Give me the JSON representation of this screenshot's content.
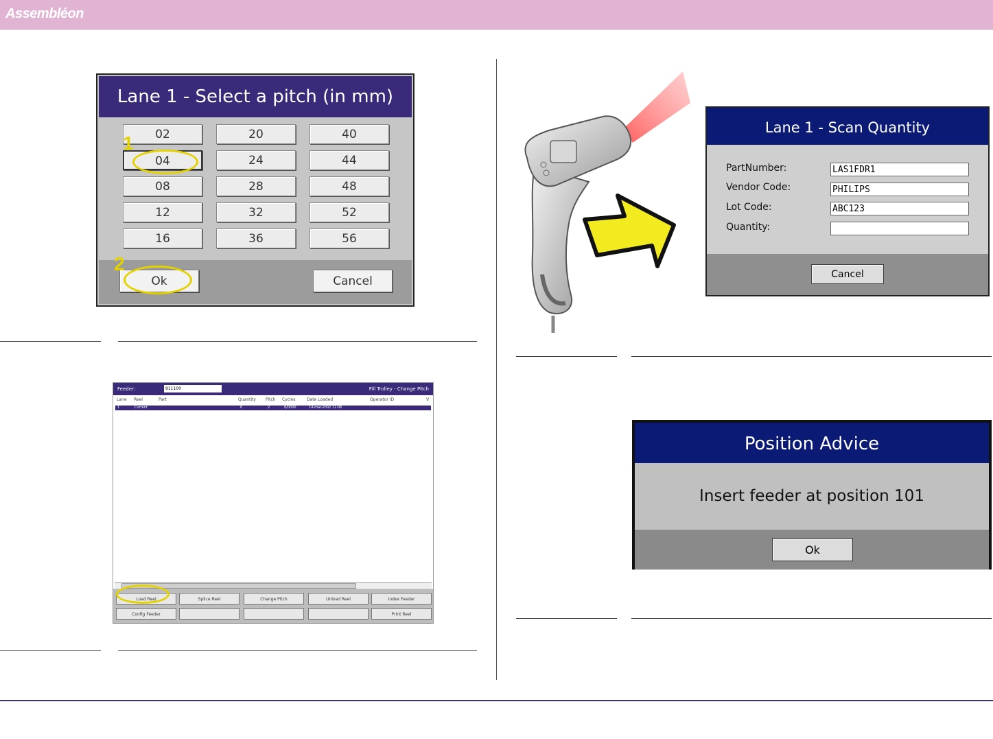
{
  "header": {
    "logo": "Assembléon",
    "bar_color": "#e2b4d4"
  },
  "pitch_dialog": {
    "title": "Lane 1 - Select a pitch (in mm)",
    "options": [
      [
        "02",
        "20",
        "40"
      ],
      [
        "04",
        "24",
        "44"
      ],
      [
        "08",
        "28",
        "48"
      ],
      [
        "12",
        "32",
        "52"
      ],
      [
        "16",
        "36",
        "56"
      ]
    ],
    "selected": "04",
    "ok_label": "Ok",
    "cancel_label": "Cancel",
    "markers": [
      "1",
      "2"
    ]
  },
  "trolley_screen": {
    "feeder_label": "Feeder:",
    "feeder_value": "911100",
    "mode": "Fill Trolley - Change Pitch",
    "columns": [
      "Lane",
      "Reel",
      "Part",
      "Quantity",
      "Pitch",
      "Cycles",
      "Date Loaded",
      "Operator ID",
      "V"
    ],
    "row": [
      "1",
      "Current",
      "",
      "0",
      "2",
      "0/0000",
      "14-mar-2002 11:06",
      "",
      ""
    ],
    "buttons_row1": [
      "Load Reel",
      "Splice Reel",
      "Change Pitch",
      "Unload Reel",
      "Index Feeder"
    ],
    "buttons_row2": [
      "Config Feeder",
      "",
      "",
      "",
      "Print Reel"
    ]
  },
  "scan_dialog": {
    "title": "Lane 1 - Scan Quantity",
    "fields": [
      {
        "label": "PartNumber:",
        "value": "LAS1FDR1"
      },
      {
        "label": "Vendor Code:",
        "value": "PHILIPS"
      },
      {
        "label": "Lot Code:",
        "value": "ABC123"
      },
      {
        "label": "Quantity:",
        "value": ""
      }
    ],
    "cancel_label": "Cancel"
  },
  "advice_dialog": {
    "title": "Position Advice",
    "message": "Insert feeder at position 101",
    "ok_label": "Ok"
  },
  "icons": {
    "scanner": "barcode-scanner-icon",
    "arrow": "yellow-arrow-icon",
    "laser": "laser-beam-icon"
  }
}
